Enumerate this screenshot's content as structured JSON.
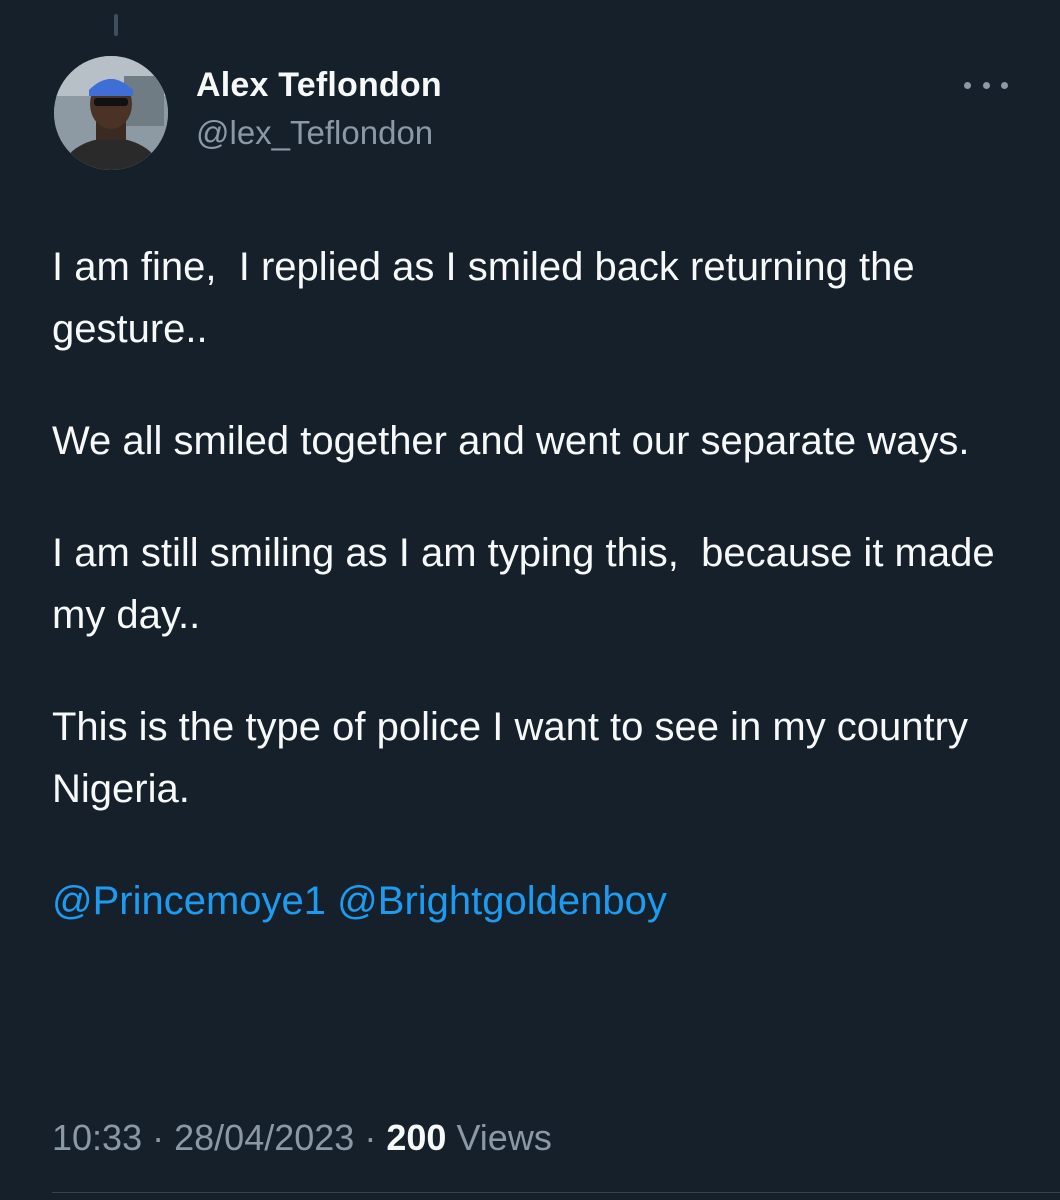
{
  "tweet": {
    "author": {
      "display_name": "Alex Teflondon",
      "handle": "@lex_Teflondon",
      "avatar_icon": "avatar-photo"
    },
    "more_icon": "more-horizontal-icon",
    "paragraphs": [
      "I am fine,  I replied as I smiled back returning the gesture..",
      "We all smiled together and went our separate ways.",
      "I am still smiling as I am typing this,  because it made my day..",
      "This is the type of police I want to see in my country Nigeria."
    ],
    "mentions": [
      "@Princemoye1",
      "@Brightgoldenboy"
    ],
    "time": "10:33",
    "date": "28/04/2023",
    "separator": "·",
    "views_count": "200",
    "views_label": "Views"
  },
  "colors": {
    "background": "#15202b",
    "text": "#f7f9f9",
    "secondary": "#8b98a5",
    "link": "#1d9bf0"
  }
}
